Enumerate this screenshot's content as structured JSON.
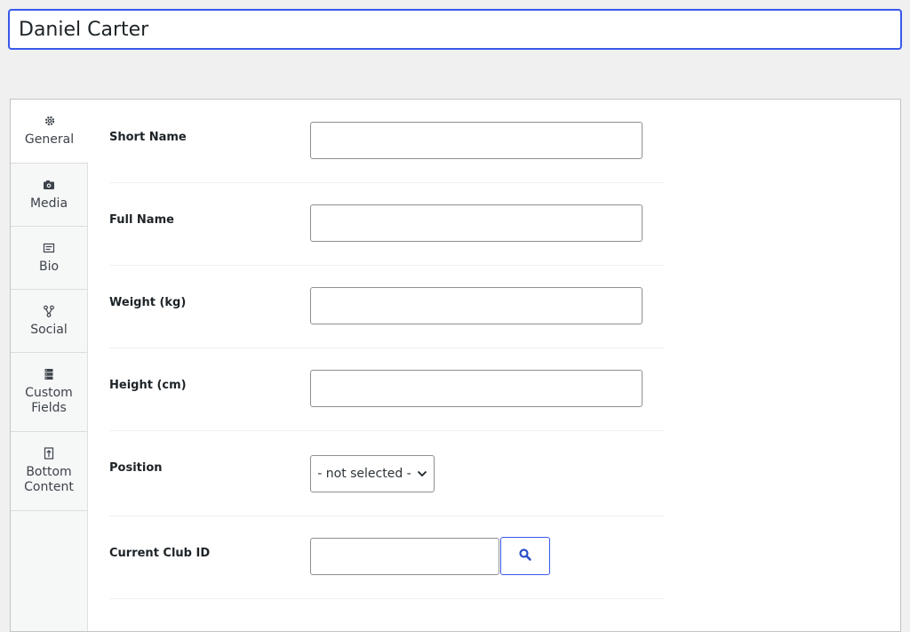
{
  "title": {
    "value": "Daniel Carter"
  },
  "tabs": [
    {
      "label": "General",
      "icon": "gear-icon",
      "active": true
    },
    {
      "label": "Media",
      "icon": "camera-icon"
    },
    {
      "label": "Bio",
      "icon": "text-icon"
    },
    {
      "label": "Social",
      "icon": "share-icon"
    },
    {
      "label": "Custom\nFields",
      "icon": "database-icon"
    },
    {
      "label": "Bottom\nContent",
      "icon": "page-icon"
    }
  ],
  "form": {
    "short_name": {
      "label": "Short Name",
      "value": ""
    },
    "full_name": {
      "label": "Full Name",
      "value": ""
    },
    "weight": {
      "label": "Weight (kg)",
      "value": ""
    },
    "height": {
      "label": "Height (cm)",
      "value": ""
    },
    "position": {
      "label": "Position",
      "selected": "- not selected -"
    },
    "club_id": {
      "label": "Current Club ID",
      "value": ""
    }
  },
  "colors": {
    "accent": "#3858e9",
    "panel_bg": "#ffffff",
    "page_bg": "#f0f0f1"
  }
}
